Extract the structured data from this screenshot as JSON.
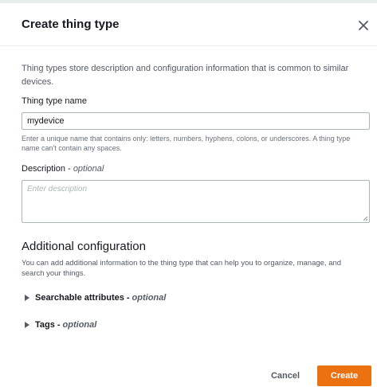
{
  "modal": {
    "title": "Create thing type",
    "close_icon": "close-icon",
    "intro": "Thing types store description and configuration information that is common to similar devices."
  },
  "name_field": {
    "label": "Thing type name",
    "value": "mydevice",
    "hint": "Enter a unique name that contains only: letters, numbers, hyphens, colons, or underscores. A thing type name can't contain any spaces."
  },
  "description_field": {
    "label": "Description",
    "separator": " - ",
    "optional": "optional",
    "placeholder": "Enter description",
    "value": ""
  },
  "additional": {
    "title": "Additional configuration",
    "description": "You can add additional information to the thing type that can help you to organize, manage, and search your things.",
    "sections": [
      {
        "label": "Searchable attributes",
        "optional": "optional",
        "icon": "caret-right-icon"
      },
      {
        "label": "Tags",
        "optional": "optional",
        "icon": "caret-right-icon"
      }
    ]
  },
  "footer": {
    "cancel_label": "Cancel",
    "create_label": "Create"
  },
  "colors": {
    "primary_button": "#ec7211",
    "text": "#16191f",
    "muted_text": "#545b64",
    "border": "#aab7b8"
  }
}
